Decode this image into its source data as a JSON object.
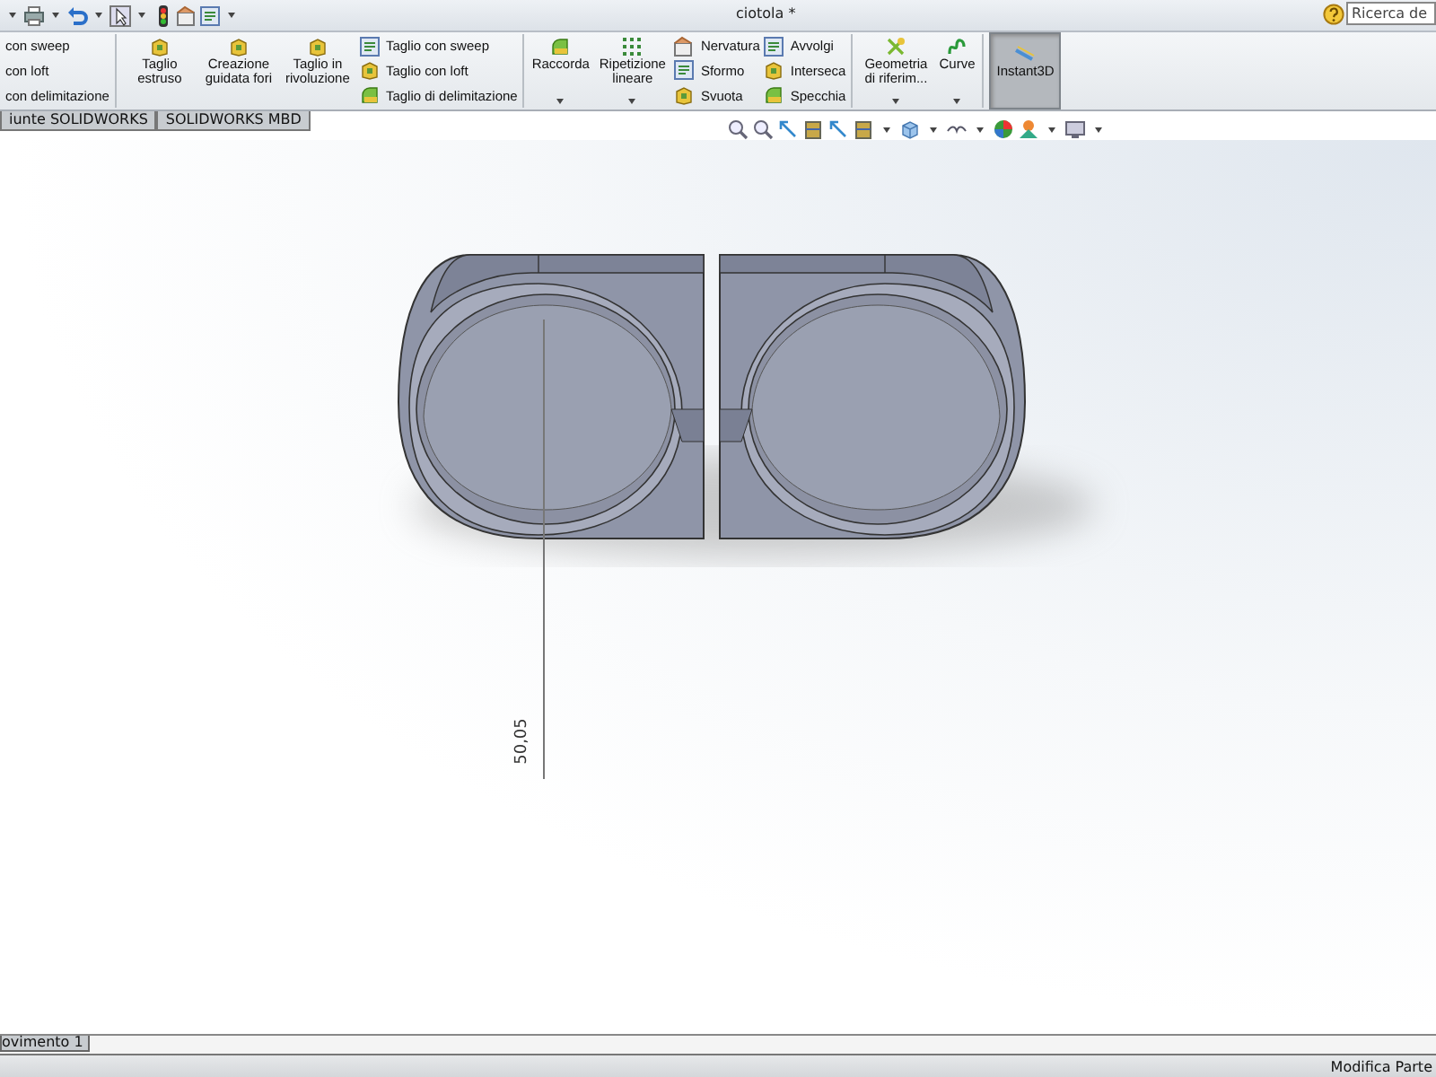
{
  "window": {
    "title": "ciotola *"
  },
  "search": {
    "placeholder": "Ricerca de"
  },
  "ribbon": {
    "groups": [
      [
        {
          "kind": "list",
          "entries": [
            "con sweep",
            "con loft",
            "con delimitazione"
          ]
        }
      ],
      [
        {
          "kind": "large",
          "label": "Taglio estruso",
          "dropdown": false
        },
        {
          "kind": "large",
          "label": "Creazione guidata fori",
          "dropdown": false
        },
        {
          "kind": "large",
          "label": "Taglio in rivoluzione",
          "dropdown": false
        },
        {
          "kind": "list",
          "entries": [
            "Taglio con sweep",
            "Taglio con loft",
            "Taglio di delimitazione"
          ]
        }
      ],
      [
        {
          "kind": "large",
          "label": "Raccorda",
          "dropdown": true
        },
        {
          "kind": "large",
          "label": "Ripetizione lineare",
          "dropdown": true
        },
        {
          "kind": "list",
          "entries": [
            "Nervatura",
            "Sformo",
            "Svuota"
          ]
        },
        {
          "kind": "list",
          "entries": [
            "Avvolgi",
            "Interseca",
            "Specchia"
          ]
        }
      ],
      [
        {
          "kind": "large",
          "label": "Geometria di riferim...",
          "dropdown": true
        },
        {
          "kind": "large",
          "label": "Curve",
          "dropdown": true
        }
      ],
      [
        {
          "kind": "toggle",
          "label": "Instant3D",
          "selected": true
        }
      ]
    ]
  },
  "tabs": [
    {
      "label": "iunte SOLIDWORKS"
    },
    {
      "label": "SOLIDWORKS MBD"
    }
  ],
  "viewport": {
    "dimension": "50,05"
  },
  "bottom_tabs": [
    {
      "label": "ovimento 1"
    }
  ],
  "status_bar": {
    "text": "Modifica Parte"
  }
}
